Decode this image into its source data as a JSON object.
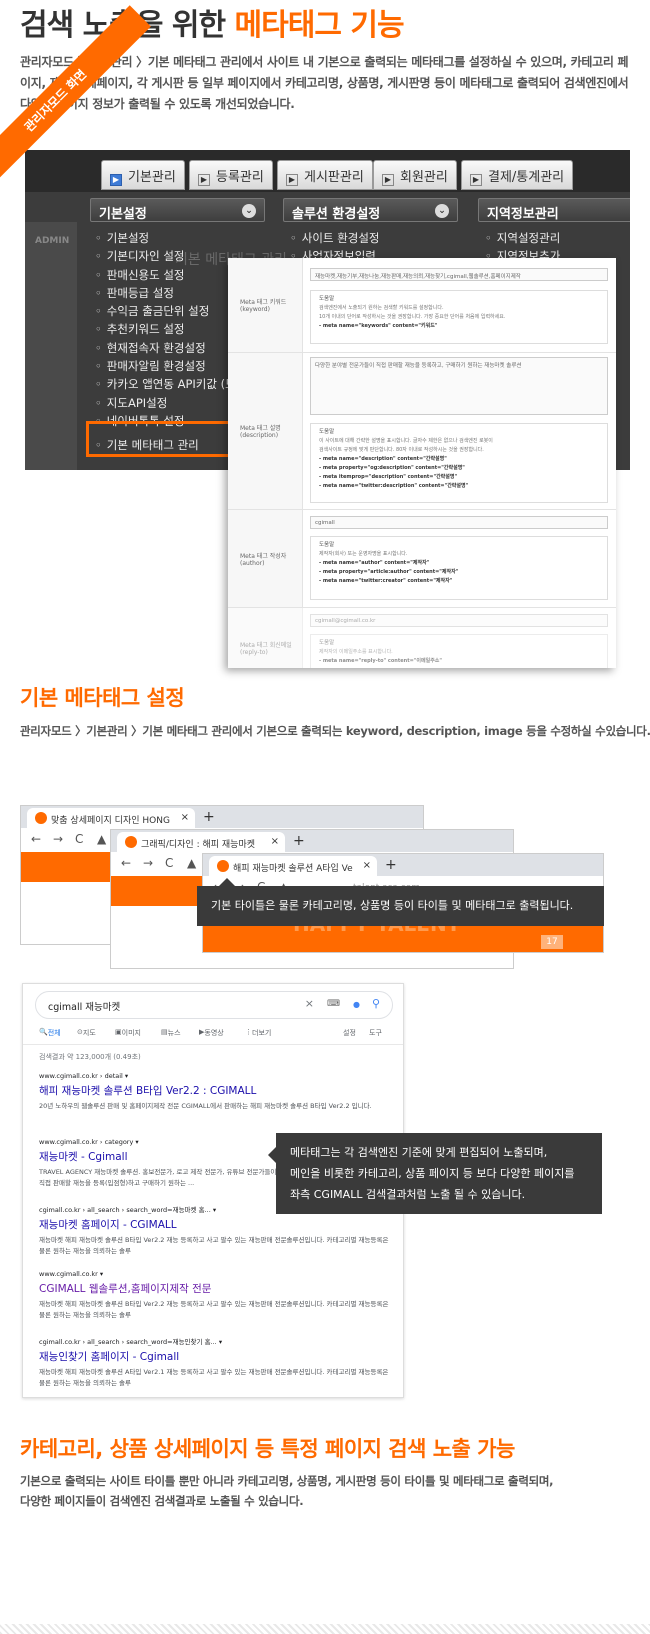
{
  "hero": {
    "title_plain": "검색 노출을 위한 ",
    "title_highlight": "메타태그 기능",
    "intro": "관리자모드 〉기본관리 〉기본 메타태그 관리에서 사이트 내 기본으로 출력되는 메타태그를 설정하실 수 있으며, 카테고리 페이지, 재능 상세페이지, 각 게시판 등 일부 페이지에서 카테고리명, 상품명, 게시판명 등이 메타태그로 출력되어 검색엔진에서 다양한 페이지 정보가 출력될 수 있도록 개선되었습니다."
  },
  "admin": {
    "ribbon": "관리자모드 화면",
    "side_label": "ADMIN",
    "tabs": [
      "기본관리",
      "등록관리",
      "게시판관리",
      "회원관리",
      "결제/통계관리"
    ],
    "submenus": [
      "기본설정",
      "솔루션 환경설정",
      "지역정보관리"
    ],
    "menu_col1": [
      "기본설정",
      "기본디자인 설정",
      "판매신용도 설정",
      "판매등급 설정",
      "수익금 출금단위 설정",
      "추천키워드 설정",
      "현재접속자 환경설정",
      "판매자알림 환경설정",
      "카카오 앱연동 API키값 (모바",
      "지도API설정",
      "네이버톡톡 설정",
      "기본 메타태그 관리"
    ],
    "menu_col2": [
      "사이트 환경설정",
      "사업자정보입력"
    ],
    "menu_col3": [
      "지역설정관리",
      "지역정보추가"
    ],
    "bg_title": "기본 메타태그 관리"
  },
  "form": {
    "rows": [
      {
        "label": "Meta 태그 키워드\n(keyword)",
        "value": "재능마켓,재능기부,재능나눔,재능판매,재능의뢰,재능찾기,cgimall,웹솔루션,홈페이지제작",
        "help_title": "도움말",
        "help_lines": [
          "검색엔진에서 노출되기 원하는 검색할 키워드를 설정합니다.",
          "10개 이내의 단어로 작성하시는 것을 권장합니다. 가장 중요한 단어를 처음에 입력하세요."
        ],
        "code_lines": [
          "- meta name=\"keywords\" content=\"키워드\""
        ]
      },
      {
        "label": "Meta 태그 설명\n(description)",
        "value": "다양한 분야별 전문가들이 직접 판매할 재능을 등록하고, 구매하기 원하는 재능마켓 솔루션",
        "help_title": "도움말",
        "help_lines": [
          "이 사이트에 대해 간략한 설명을 표시합니다. 글자수 제한은 없으나 검색엔진 로봇이",
          "검색사이트 규정에 맞게 판단합니다. 80자 이내로 작성하시는 것을 권장합니다."
        ],
        "code_lines": [
          "- meta name=\"description\" content=\"간략설명\"",
          "- meta property=\"og:description\" content=\"간략설명\"",
          "- meta itemprop=\"description\" content=\"간략설명\"",
          "- meta name=\"twitter:description\" content=\"간략설명\""
        ]
      },
      {
        "label": "Meta 태그 작성자\n(author)",
        "value": "cgimall",
        "help_title": "도움말",
        "help_lines": [
          "제작자(회사) 또는 운영자명을 표시합니다."
        ],
        "code_lines": [
          "- meta name=\"author\" content=\"제작자\"",
          "- meta property=\"article:author\" content=\"제작자\"",
          "- meta name=\"twitter:creator\" content=\"제작자\""
        ]
      },
      {
        "label": "Meta 태그 회신메일\n(reply-to)",
        "value": "cgimall@cgimall.co.kr",
        "help_title": "도움말",
        "help_lines": [
          "제작자의 이메일주소를 표시합니다."
        ],
        "code_lines": [
          "- meta name=\"reply-to\" content=\"이메일주소\""
        ]
      }
    ]
  },
  "section2": {
    "title": "기본 메타태그 설정",
    "text": "관리자모드 〉기본관리 〉기본 메타태그 관리에서 기본으로 출력되는 keyword, description, image 등을 수정하실 수있습니다."
  },
  "browsers": [
    {
      "tab": "맞춤 상세페이지 디자인 HONG",
      "close": "×",
      "plus": "+"
    },
    {
      "tab": "그래픽/디자인 : 해피 재능마켓",
      "close": "×",
      "plus": "+"
    },
    {
      "tab": "해피 재능마켓 솔루션 A타입 Ve",
      "close": "×",
      "plus": "+",
      "url": "talent.asa.com",
      "banner": "HAPPY TALENT",
      "badge": "17"
    }
  ],
  "nav_glyphs": {
    "back": "←",
    "fwd": "→",
    "reload": "C",
    "warn": "▲"
  },
  "tip1": "기본 타이틀은 물론 카테고리명, 상품명 등이 타이틀 및 메타태그로 출력됩니다.",
  "serp": {
    "query": "cgimall 재능마켓",
    "tabs": [
      "전체",
      "지도",
      "이미지",
      "뉴스",
      "동영상",
      "더보기",
      "설정",
      "도구"
    ],
    "count": "검색결과 약 123,000개 (0.49초)",
    "results": [
      {
        "url": "www.cgimall.co.kr › detail ▾",
        "title": "해피 재능마켓 솔루션 B타입 Ver2.2 : CGIMALL",
        "desc": "20년 노하우의 웹솔루션 판매 및 홈페이지제작 전문 CGIMALL에서 판매하는 해피 재능마켓 솔루션 B타입 Ver2.2 입니다."
      },
      {
        "url": "www.cgimall.co.kr › category ▾",
        "title": "재능마켓 - Cgimall",
        "desc": "TRAVEL AGENCY 재능마켓 솔루션. 홍보전문가, 로고 제작 전문가, 유튜브 전문가들이 직접 판매할 재능을 등록(입점형)하고 구매하기 원하는 ..."
      },
      {
        "url": "cgimall.co.kr › all_search › search_word=재능마켓 홈... ▾",
        "title": "재능마켓 홈페이지 - CGIMALL",
        "desc": "재능마켓 해피 재능마켓 솔루션 B타입 Ver2.2 재능 등록하고 사고 팔수 있는 재능판매 전문솔루션입니다. 카테고리별 재능등록은 물론 원하는 재능을 의뢰하는 솔루"
      },
      {
        "url": "www.cgimall.co.kr ▾",
        "title": "CGIMALL 웹솔루션,홈페이지제작 전문",
        "desc": "재능마켓 해피 재능마켓 솔루션 B타입 Ver2.2 재능 등록하고 사고 팔수 있는 재능판매 전문솔루션입니다. 카테고리별 재능등록은 물론 원하는 재능을 의뢰하는 솔루"
      },
      {
        "url": "cgimall.co.kr › all_search › search_word=재능인찾기 홈... ▾",
        "title": "재능인찾기 홈페이지 - Cgimall",
        "desc": "재능마켓 해피 재능마켓 솔루션 A타입 Ver2.1 재능 등록하고 사고 팔수 있는 재능판매 전문솔루션입니다. 카테고리별 재능등록은 물론 원하는 재능을 의뢰하는 솔루"
      }
    ],
    "icons": {
      "clear": "×",
      "mic": "●",
      "search": "⚲"
    }
  },
  "tip2": [
    "메타태그는 각 검색엔진 기준에 맞게 편집되어 노출되며,",
    "메인을 비롯한 카테고리, 상품 페이지 등 보다 다양한 페이지를",
    "좌측 CGIMALL 검색결과처럼 노출 될 수 있습니다."
  ],
  "section3": {
    "title": "카테고리, 상품 상세페이지 등 특정 페이지 검색 노출 가능",
    "lines": [
      "기본으로 출력되는 사이트 타이틀 뿐만 아니라 카테고리명, 상품명, 게시판명 등이 타이틀 및 메타태그로 출력되며,",
      "다양한 페이지들이 검색엔진 검색결과로 노출될 수 있습니다."
    ]
  },
  "colors": {
    "accent": "#ff6a00",
    "link": "#1a0dab",
    "tooltip": "#3a3a3a"
  }
}
